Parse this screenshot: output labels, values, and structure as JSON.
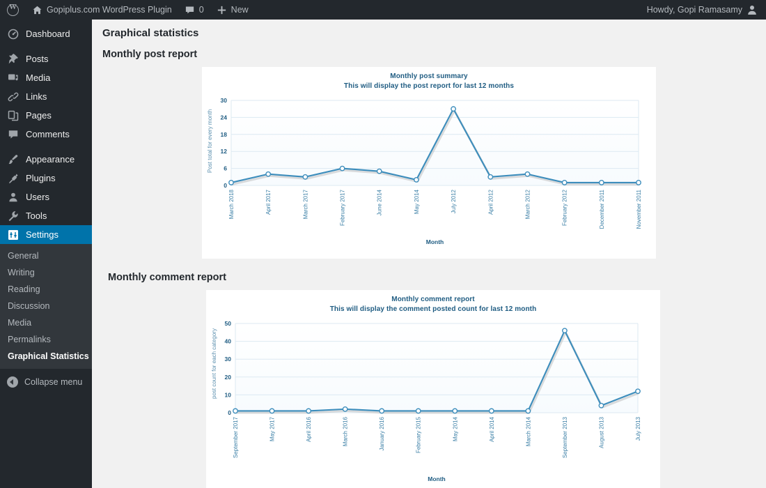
{
  "adminbar": {
    "logo_icon": "wordpress-logo-icon",
    "home_icon": "home-icon",
    "site_name": "Gopiplus.com WordPress Plugin",
    "comments_icon": "comment-bubble-icon",
    "comments_count": "0",
    "new_icon": "plus-icon",
    "new_label": "New",
    "howdy": "Howdy, Gopi Ramasamy",
    "avatar_icon": "user-avatar-icon"
  },
  "sidebar": {
    "items": [
      {
        "label": "Dashboard",
        "icon": "dashboard-icon",
        "current": false
      },
      {
        "label": "Posts",
        "icon": "pin-icon",
        "current": false
      },
      {
        "label": "Media",
        "icon": "media-icon",
        "current": false
      },
      {
        "label": "Links",
        "icon": "link-icon",
        "current": false
      },
      {
        "label": "Pages",
        "icon": "pages-icon",
        "current": false
      },
      {
        "label": "Comments",
        "icon": "comment-icon",
        "current": false
      },
      {
        "label": "Appearance",
        "icon": "brush-icon",
        "current": false
      },
      {
        "label": "Plugins",
        "icon": "plug-icon",
        "current": false
      },
      {
        "label": "Users",
        "icon": "user-icon",
        "current": false
      },
      {
        "label": "Tools",
        "icon": "wrench-icon",
        "current": false
      },
      {
        "label": "Settings",
        "icon": "settings-sliders-icon",
        "current": true
      }
    ],
    "submenu": [
      {
        "label": "General",
        "current": false
      },
      {
        "label": "Writing",
        "current": false
      },
      {
        "label": "Reading",
        "current": false
      },
      {
        "label": "Discussion",
        "current": false
      },
      {
        "label": "Media",
        "current": false
      },
      {
        "label": "Permalinks",
        "current": false
      },
      {
        "label": "Graphical Statistics",
        "current": true
      }
    ],
    "collapse_label": "Collapse menu",
    "collapse_icon": "collapse-arrow-icon"
  },
  "main": {
    "page_title": "Graphical statistics",
    "section_post": "Monthly post report",
    "section_comment": "Monthly comment report"
  },
  "colors": {
    "line": "#3c8dbc",
    "marker_stroke": "#3c8dbc",
    "marker_fill": "#ffffff",
    "grid": "#dce9f2",
    "plot_bg_top": "#ffffff",
    "plot_bg_bottom": "#f7fbfe",
    "text_blue": "#1f5c82",
    "admin_bg": "#23282d",
    "submenu_bg": "#32373c",
    "accent": "#0073aa"
  },
  "chart_data": [
    {
      "type": "line",
      "title": "Monthly post summary",
      "subtitle": "This will display the post report for last 12 months",
      "xlabel": "Month",
      "ylabel": "Post total for every month",
      "categories": [
        "March 2018",
        "April 2017",
        "March 2017",
        "February 2017",
        "June 2014",
        "May 2014",
        "July 2012",
        "April 2012",
        "March 2012",
        "February 2012",
        "December 2011",
        "November 2011"
      ],
      "values": [
        1,
        4,
        3,
        6,
        5,
        2,
        27,
        3,
        4,
        1,
        1,
        1
      ],
      "yticks": [
        0,
        6,
        12,
        18,
        24,
        30
      ],
      "ylim": [
        0,
        30
      ],
      "grid": true,
      "legend": false
    },
    {
      "type": "line",
      "title": "Monthly comment report",
      "subtitle": "This will display the comment posted count for last 12 month",
      "xlabel": "Month",
      "ylabel": "post count for each category",
      "categories": [
        "September 2017",
        "May 2017",
        "April 2016",
        "March 2016",
        "January 2016",
        "February 2015",
        "May 2014",
        "April 2014",
        "March 2014",
        "September 2013",
        "August 2013",
        "July 2013"
      ],
      "values": [
        1,
        1,
        1,
        2,
        1,
        1,
        1,
        1,
        1,
        46,
        4,
        12
      ],
      "yticks": [
        0,
        10,
        20,
        30,
        40,
        50
      ],
      "ylim": [
        0,
        50
      ],
      "grid": true,
      "legend": false
    }
  ]
}
